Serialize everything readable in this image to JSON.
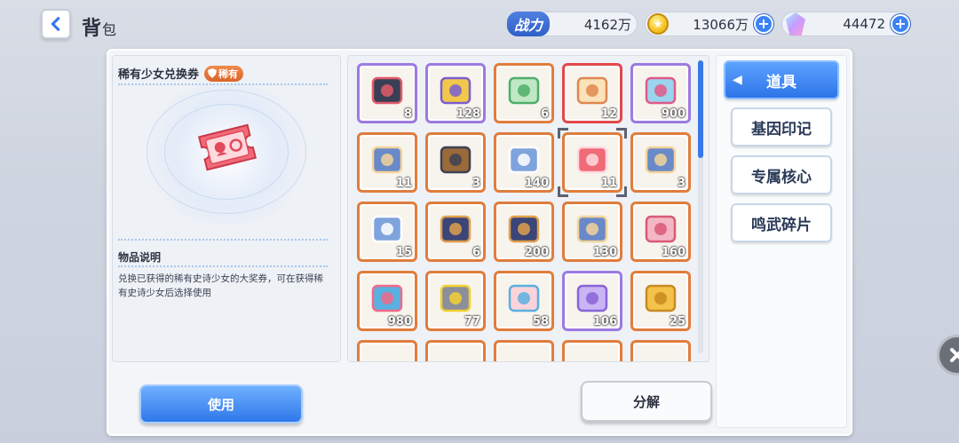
{
  "header": {
    "title": "背",
    "title_sub": "包",
    "power_label": "战力",
    "power_value": "4162万",
    "gold_value": "13066万",
    "gem_value": "44472"
  },
  "detail": {
    "item_name": "稀有少女兑换券",
    "rarity": "稀有",
    "desc_heading": "物品说明",
    "desc_text": "兑换已获得的稀有史诗少女的大奖券，可在获得稀有史诗少女后选择使用"
  },
  "grid": {
    "rows": [
      [
        {
          "count": "8",
          "frame": "purple",
          "icon": "dark-can-icon"
        },
        {
          "count": "128",
          "frame": "purple",
          "icon": "gold-can-icon"
        },
        {
          "count": "6",
          "frame": "orange",
          "icon": "green-orb-icon"
        },
        {
          "count": "12",
          "frame": "red",
          "icon": "cream-orb-icon"
        },
        {
          "count": "900",
          "frame": "purple",
          "icon": "dna-icon"
        }
      ],
      [
        {
          "count": "11",
          "frame": "orange",
          "icon": "blue-box-icon"
        },
        {
          "count": "3",
          "frame": "orange",
          "icon": "wood-chest-icon"
        },
        {
          "count": "140",
          "frame": "orange",
          "icon": "winged-box-icon"
        },
        {
          "count": "11",
          "frame": "orange",
          "icon": "pink-ticket-icon"
        },
        {
          "count": "3",
          "frame": "orange",
          "icon": "blue-box-icon"
        }
      ],
      [
        {
          "count": "15",
          "frame": "orange",
          "icon": "winged-box-icon"
        },
        {
          "count": "6",
          "frame": "orange",
          "icon": "navy-chest-icon"
        },
        {
          "count": "200",
          "frame": "orange",
          "icon": "navy-chest-icon"
        },
        {
          "count": "130",
          "frame": "orange",
          "icon": "blue-box-icon"
        },
        {
          "count": "160",
          "frame": "orange",
          "icon": "pink-bag-icon"
        }
      ],
      [
        {
          "count": "980",
          "frame": "orange",
          "icon": "party-basket-icon"
        },
        {
          "count": "77",
          "frame": "orange",
          "icon": "star-crate-icon"
        },
        {
          "count": "58",
          "frame": "orange",
          "icon": "shirt-ticket-icon"
        },
        {
          "count": "106",
          "frame": "purple",
          "icon": "smile-ticket-icon"
        },
        {
          "count": "25",
          "frame": "orange",
          "icon": "gold-card-icon"
        }
      ]
    ]
  },
  "tabs": [
    "道具",
    "基因印记",
    "专属核心",
    "鸣武碎片"
  ],
  "buttons": {
    "use": "使用",
    "decompose": "分解"
  }
}
